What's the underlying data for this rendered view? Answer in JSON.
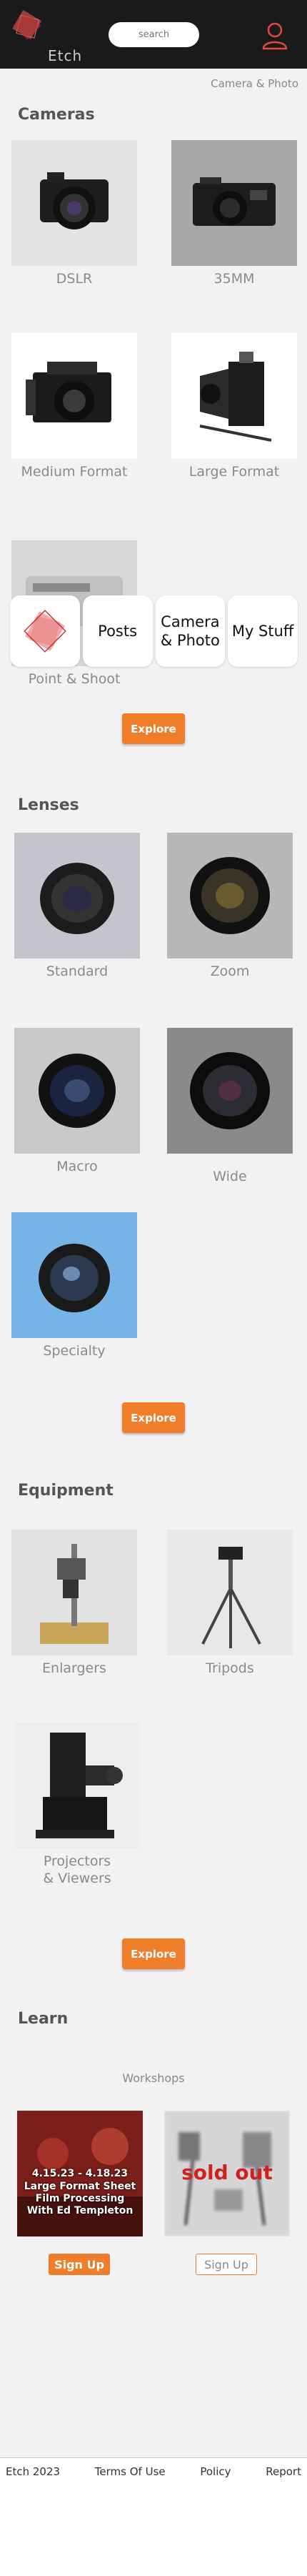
{
  "header": {
    "logo_text": "Etch",
    "search_placeholder": "search"
  },
  "breadcrumb": "Camera & Photo",
  "cameras": {
    "title": "Cameras",
    "items": [
      "DSLR",
      "35MM",
      "Medium Format",
      "Large Format",
      "Point & Shoot"
    ],
    "explore_label": "Explore"
  },
  "bottom_nav": {
    "items": [
      "Posts",
      "Camera & Photo",
      "My Stuff"
    ]
  },
  "lenses": {
    "title": "Lenses",
    "items": [
      "Standard",
      "Zoom",
      "Macro",
      "Wide",
      "Specialty"
    ],
    "explore_label": "Explore"
  },
  "equipment": {
    "title": "Equipment",
    "items": [
      "Enlargers",
      "Tripods",
      "Projectors & Viewers"
    ],
    "explore_label": "Explore"
  },
  "learn": {
    "title": "Learn",
    "subtitle": "Workshops",
    "workshop1": {
      "dates": "4.15.23 - 4.18.23",
      "title": "Large Format Sheet Film Processing With Ed Templeton",
      "signup_label": "Sign Up"
    },
    "workshop2": {
      "status": "sold out",
      "signup_label": "Sign Up"
    }
  },
  "footer": {
    "links": [
      "Etch 2023",
      "Terms Of Use",
      "Policy",
      "Report"
    ]
  },
  "colors": {
    "accent": "#f07d2a",
    "header_bg": "#1a1a1a",
    "logo_red": "#d33a3a"
  }
}
